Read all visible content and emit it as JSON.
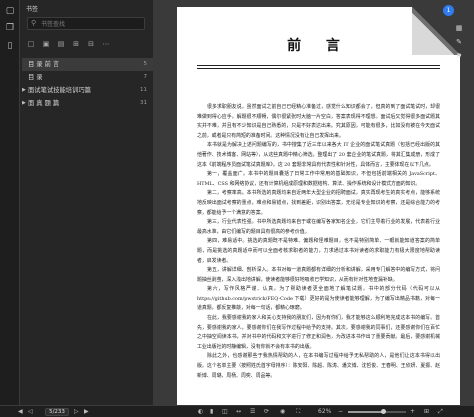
{
  "sidebar": {
    "title": "书签",
    "search_placeholder": "书签查找",
    "rail_icons": [
      "file-icon",
      "copy-icon",
      "bookmark-icon"
    ],
    "toolbar_icons": [
      "add-bookmark-icon",
      "add-sub-bookmark-icon",
      "bookmark-list-icon",
      "expand-icon",
      "collapse-icon",
      "more-icon"
    ],
    "items": [
      {
        "label": "目  录  前  言",
        "number": "5",
        "active": true,
        "expandable": false
      },
      {
        "label": "目  录",
        "number": "7",
        "active": false,
        "expandable": false
      },
      {
        "label": "面试笔试技能培训巧篇",
        "number": "11",
        "active": false,
        "expandable": true
      },
      {
        "label": "面  真  题  篇",
        "number": "31",
        "active": false,
        "expandable": true
      }
    ]
  },
  "document": {
    "title": "前  言",
    "badge": "1",
    "paragraphs": [
      "很多求职朋友说，虽然面试之前自己已经精心准备过，感觉什么知识都会了，但真的到了面试笔试时，却很难做到得心应手。解题很不顺畅，偶尔很紧张时大脑一片空白，答案表现得不理想。面试后又觉得很多面试题其实并不难，并且有不少知识是自己熟悉的，只是不好表达出来。究其原因，可能有很多，比如没有被在今天面试之前，或者是只有简短的准备时间。这种情况没有让自己发挥出来。",
      "本书就是为解决上述问题编写的，书中搜集了近三年以来各大 IT 企业的面试笔试真题（包括已经出版的其他著作、技术博客、网站等），从这些真题中精心筛选，整理出了 20 套企业的笔试真题，将其汇集成册，形成了这本《前端程序员面试笔试真题库》。这 20 套题非常具有代表性和针对性，具体而言，主要体现在以下几点。",
      "第一，覆盖面广。本书中的题目囊括了日常工作中常用的基础知识，不但包括前端相关的 JavaScript、HTML、CSS 和网络协议，还有计算机组成原理和数据结构、算法、操作系统和设计模式方面的知识。",
      "第二，考察率高。本书所选的真题均来自近两年大型企业的招聘面试，真实再现考生的真实考点，能够系统地反映出面试考察的重点，难点和易错点，找到差距，识别出答案，无论是专业知识的考察，还是综合能力的考察，都能给予一个满意的答案。",
      "第三，行业代表性强。书中所选真题均来自于或在编写各家知名企业，它们主导着行业的发展，代表着行业最高水准，由它们编写的题目具有很高的参考价值。",
      "第四，难易适中。挑选的真题既不是特难、偏题和怪难题目，也不是特别简单、一眼就能知道答案的简单题，而是挑选的真题适中而可以全面考核求职者的能力，力求通过本书对读者的求职能力有极大限度地帮助读者，启发读者。",
      "第五，讲解详细、剖析深入。本书对每一道真题都有详细的分析和讲解，采用专门解答中的编写方式，将问题抽丝剥茧，深入浅出地讲解，使读者能够很好地吸收已学知识，从而有针对性地查漏补缺。",
      "第六，写作风格严谨、认真。为了帮助读者更全面地了解笔试题，书中的部分代码（代码可以从 https://github.com/pwstrick/FEQ-Code 下载）更好的是为使读者能够理解，为了编写出精品书籍，对每一道真题，都反复推敲，对每一句话，都精心琢磨。",
      "在此，我要感谢我的家人和关心支持我的朋友们，因为有你们，我才能够这么顺利地完成这本书的编写。首先，要感谢我的家人，要感谢你们在我写作过程中给予的支持。其次，要感谢我的同事们，还要感谢你们在百忙之中抽空阅读本书，并对书中的代码和文字进行了修正和润色，为改进本书作出了重要贡献。最后，要感谢机械工业出版社的时静编辑，没有你就不会有本书的出版。",
      "除此之外，也感谢那些于我热情帮助的人，在本书编写过程中给予无私帮助的人，是他们让这本书得以出版。这个名单主要（按照姓氏首字母排序）：陈安阳、陈超、陈涛、潘文博、沈哲俊、王春明、王欣妍、夏振、赵新博、周璐、周杨、周奕、周品等。"
    ]
  },
  "status": {
    "page_current": "5",
    "page_total": "/233",
    "zoom": "62%",
    "zoom_fraction": 0.62
  }
}
